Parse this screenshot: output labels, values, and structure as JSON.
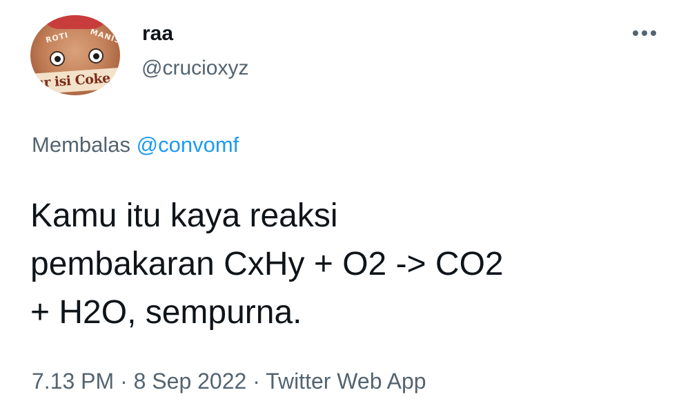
{
  "author": {
    "display_name": "raa",
    "handle": "@crucioxyz",
    "avatar_text": "ur isi Coke",
    "avatar_top_words": [
      "ROTI",
      "MANIS"
    ]
  },
  "more_icon": "more-horizontal-icon",
  "reply": {
    "prefix": "Membalas",
    "mention": "@convomf"
  },
  "tweet": {
    "lines": [
      "Kamu itu kaya reaksi",
      "pembakaran CxHy + O2 -> CO2",
      "+ H2O, sempurna."
    ]
  },
  "meta": {
    "time": "7.13 PM",
    "date": "8 Sep 2022",
    "separator": "·",
    "source": "Twitter Web App"
  },
  "colors": {
    "text": "#0f1419",
    "secondary": "#536471",
    "link": "#1d9bf0"
  }
}
